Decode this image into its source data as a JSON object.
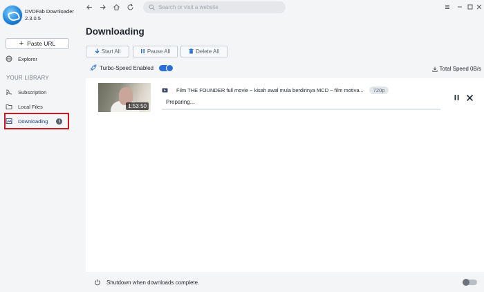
{
  "app": {
    "name_line1": "DVDFab Downloader",
    "name_line2": "2.3.0.5"
  },
  "sidebar": {
    "paste_url": "Paste URL",
    "explorer": "Explorer",
    "library_title": "YOUR LIBRARY",
    "items": [
      {
        "label": "Subscription",
        "icon": "subscription-icon"
      },
      {
        "label": "Local Files",
        "icon": "folder-icon"
      },
      {
        "label": "Downloading",
        "icon": "downloading-icon",
        "active": true
      }
    ]
  },
  "topbar": {
    "search_placeholder": "Search or visit a website"
  },
  "main": {
    "title": "Downloading",
    "actions": {
      "start_all": "Start All",
      "pause_all": "Pause All",
      "delete_all": "Delete All"
    },
    "turbo_label": "Turbo-Speed Enabled",
    "turbo_enabled": true,
    "total_speed": "Total Speed 0B/s"
  },
  "downloads": [
    {
      "title": "Film THE FOUNDER full movie ~ kisah awal  mula berdirinya MCD  ~ film motiva...",
      "quality": "720p",
      "duration": "1:53:50",
      "status": "Preparing...",
      "progress": 0
    }
  ],
  "footer": {
    "shutdown_label": "Shutdown when downloads complete.",
    "shutdown_enabled": false
  },
  "colors": {
    "accent": "#2b6fd6",
    "highlight_border": "#d0181f",
    "background": "#f4f5f7"
  }
}
